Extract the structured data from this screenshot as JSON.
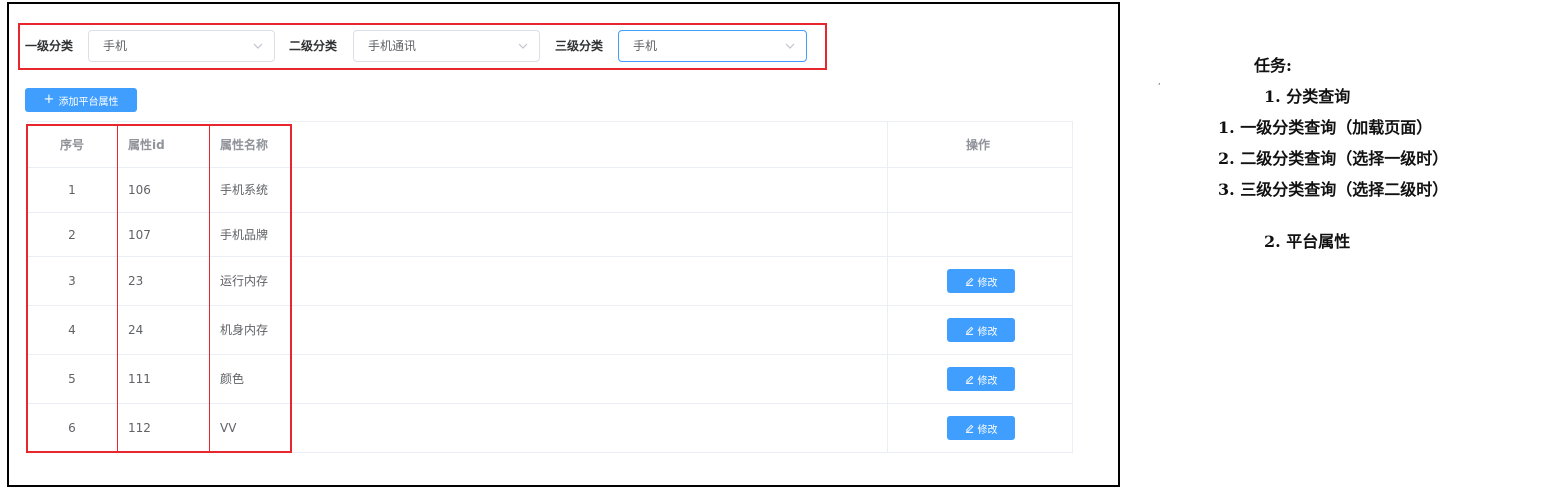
{
  "filters": [
    {
      "label": "一级分类",
      "value": "手机"
    },
    {
      "label": "二级分类",
      "value": "手机通讯"
    },
    {
      "label": "三级分类",
      "value": "手机"
    }
  ],
  "add_button_label": "添加平台属性",
  "table": {
    "columns": [
      "序号",
      "属性id",
      "属性名称",
      "操作"
    ],
    "rows": [
      {
        "idx": "1",
        "id": "106",
        "name": "手机系统",
        "has_edit": false
      },
      {
        "idx": "2",
        "id": "107",
        "name": "手机品牌",
        "has_edit": false
      },
      {
        "idx": "3",
        "id": "23",
        "name": "运行内存",
        "has_edit": true
      },
      {
        "idx": "4",
        "id": "24",
        "name": "机身内存",
        "has_edit": true
      },
      {
        "idx": "5",
        "id": "111",
        "name": "颜色",
        "has_edit": true
      },
      {
        "idx": "6",
        "id": "112",
        "name": "VV",
        "has_edit": true
      }
    ],
    "edit_label": "修改"
  },
  "notes": {
    "title": "任务:",
    "item1": "1. 分类查询",
    "sub1": "1. 一级分类查询（加载页面）",
    "sub2": "2. 二级分类查询（选择一级时）",
    "sub3": "3. 三级分类查询（选择二级时）",
    "item2": "2. 平台属性"
  },
  "colors": {
    "accent": "#409eff",
    "highlight": "#e8262e"
  }
}
